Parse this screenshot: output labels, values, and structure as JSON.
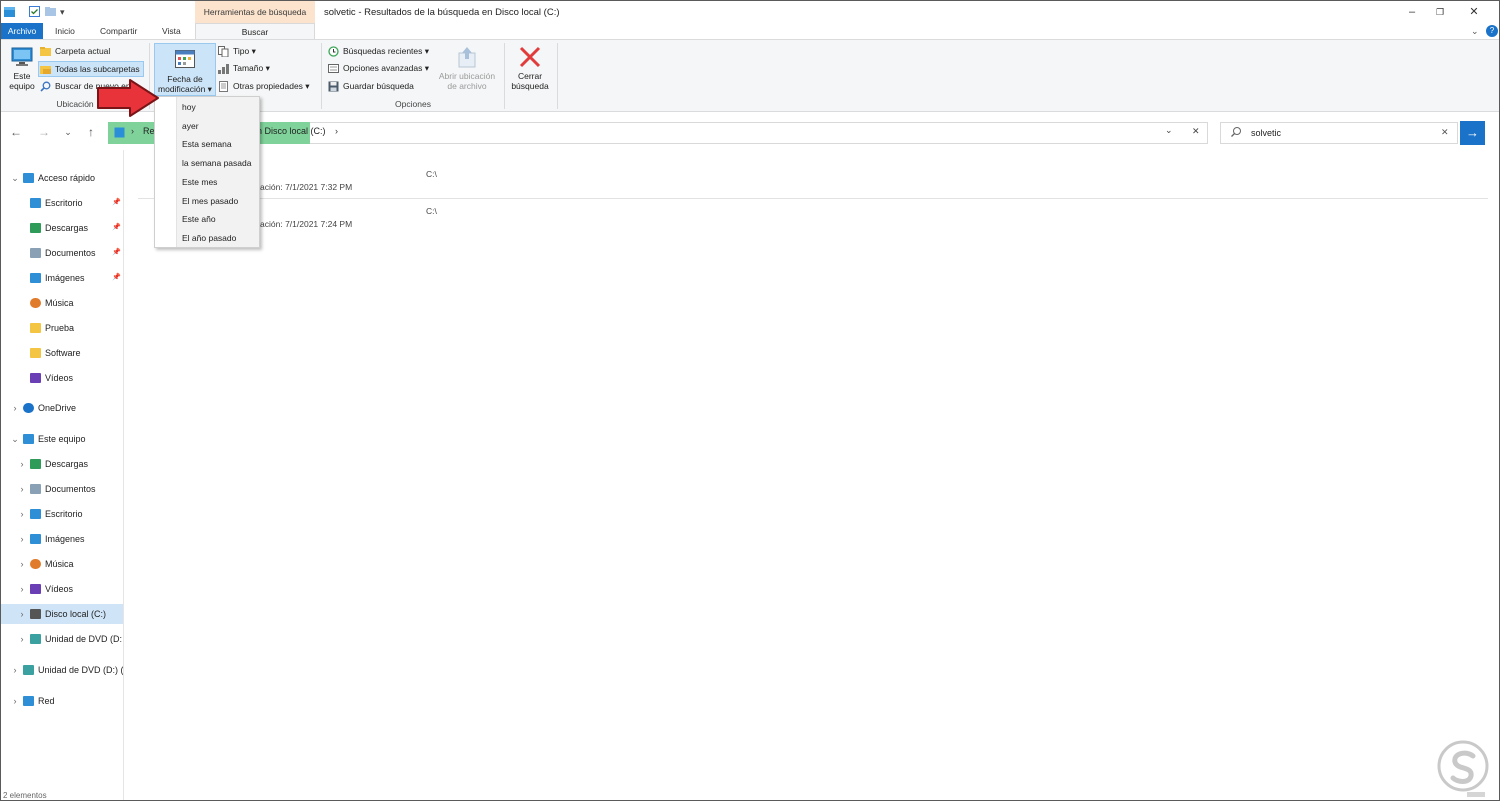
{
  "window": {
    "title": "solvetic - Resultados de la búsqueda en Disco local (C:)",
    "context_tab_label": "Herramientas de búsqueda"
  },
  "tabs": [
    "Archivo",
    "Inicio",
    "Compartir",
    "Vista",
    "Buscar"
  ],
  "ribbon": {
    "ubicacion": {
      "group_label": "Ubicación",
      "este_equipo": [
        "Este",
        "equipo"
      ],
      "carpeta_actual": "Carpeta actual",
      "todas_subcarpetas": "Todas las subcarpetas",
      "buscar_de_nuevo": "Buscar de nuevo en"
    },
    "refinar": {
      "fecha_modificacion": [
        "Fecha de",
        "modificación"
      ],
      "tipo": "Tipo",
      "tamano": "Tamaño",
      "otras_propiedades": "Otras propiedades"
    },
    "opciones": {
      "group_label": "Opciones",
      "busquedas_recientes": "Búsquedas recientes",
      "opciones_avanzadas": "Opciones avanzadas",
      "guardar_busqueda": "Guardar búsqueda",
      "abrir_ubicacion": [
        "Abrir ubicación",
        "de archivo"
      ]
    },
    "cerrar": [
      "Cerrar",
      "búsqueda"
    ]
  },
  "address": {
    "prefix": "Re",
    "location": "n Disco local (C:)"
  },
  "search": {
    "value": "solvetic"
  },
  "date_menu": [
    "hoy",
    "ayer",
    "Esta semana",
    "la semana pasada",
    "Este mes",
    "El mes pasado",
    "Este año",
    "El año pasado"
  ],
  "nav": {
    "quick_access": "Acceso rápido",
    "quick_items": [
      "Escritorio",
      "Descargas",
      "Documentos",
      "Imágenes",
      "Música",
      "Prueba",
      "Software",
      "Vídeos"
    ],
    "onedrive": "OneDrive",
    "este_equipo": "Este equipo",
    "pc_items": [
      "Descargas",
      "Documentos",
      "Escritorio",
      "Imágenes",
      "Música",
      "Vídeos",
      "Disco local (C:)",
      "Unidad de DVD (D:"
    ],
    "dvd": "Unidad de DVD (D:) (",
    "red": "Red"
  },
  "results": [
    {
      "path": "C:\\",
      "prefix": "ación:",
      "date": "7/1/2021 7:32 PM"
    },
    {
      "path": "C:\\",
      "prefix": "ación:",
      "date": "7/1/2021 7:24 PM"
    }
  ],
  "status": "2 elementos",
  "colors": {
    "accent": "#1a73c9",
    "address_green": "#7fd39a",
    "context_tab": "#fbe3cd",
    "arrow": "#e8333b"
  }
}
